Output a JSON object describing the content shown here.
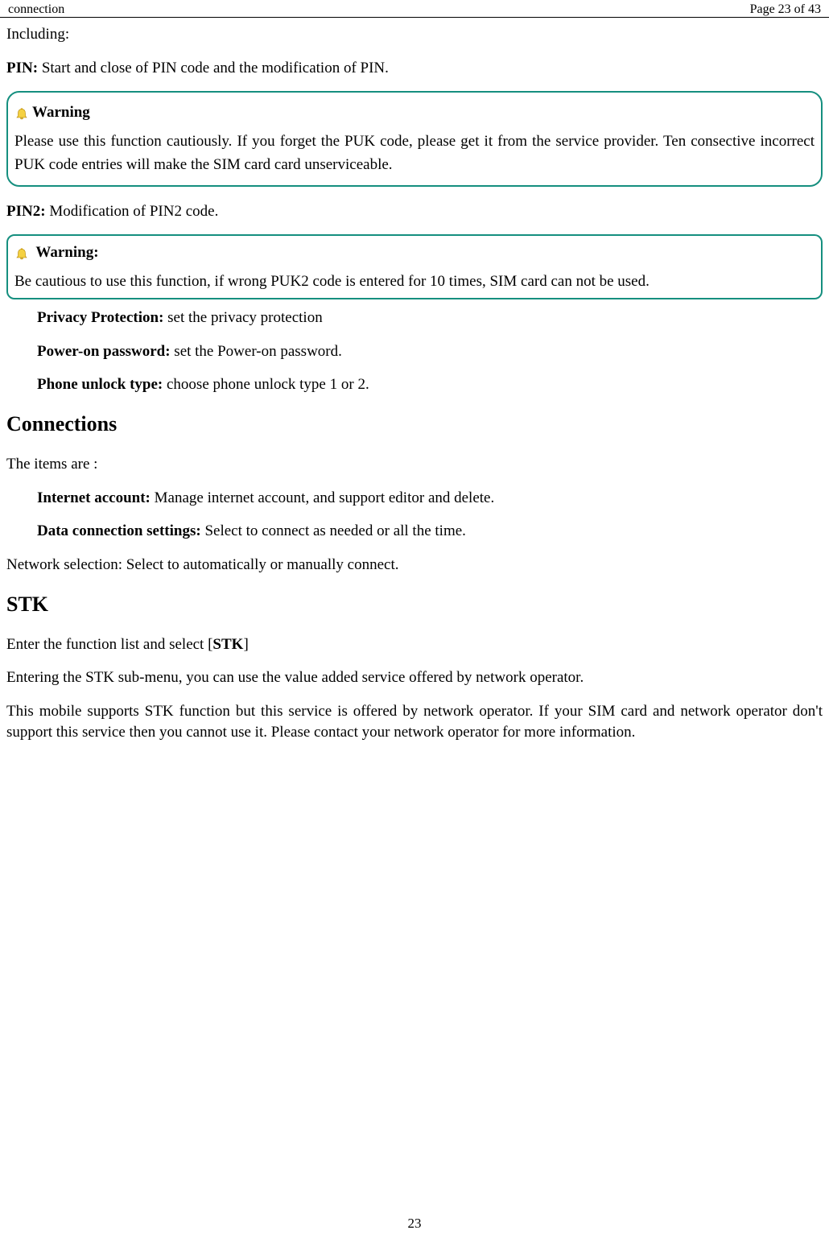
{
  "header": {
    "left": "connection",
    "right": "Page 23 of 43"
  },
  "bodyText": {
    "including": "Including:",
    "pinLabel": "PIN:",
    "pinDesc": " Start and close of PIN code and the modification of PIN.",
    "warning1Label": "Warning",
    "warning1Body": "Please use this function cautiously. If you forget the PUK code, please get it from the service provider. Ten consective incorrect PUK code entries will make the SIM card card unserviceable.",
    "pin2Label": "PIN2:",
    "pin2Desc": " Modification of PIN2 code.",
    "warning2Label": "  Warning:",
    "warning2Body": "Be cautious to use this function, if wrong PUK2 code is entered for 10 times, SIM card can not be used.",
    "privacyLabel": "Privacy Protection:",
    "privacyDesc": " set the privacy protection",
    "powerLabel": "Power-on password:",
    "powerDesc": " set the Power-on password.",
    "unlockLabel": "Phone unlock type:",
    "unlockDesc": " choose phone unlock type 1 or 2.",
    "connectionsHeading": "Connections",
    "itemsAre": "The items are :",
    "internetLabel": "Internet account:",
    "internetDesc": " Manage internet account, and support editor and delete.",
    "dataConnLabel": "Data connection settings:",
    "dataConnDesc": " Select to connect as needed or all the time.",
    "networkSel": "Network selection: Select to automatically or manually connect.",
    "stkHeading": "STK",
    "stkLine1a": "Enter the function list and select [",
    "stkLine1b": "STK",
    "stkLine1c": "]",
    "stkLine2": "Entering the STK sub-menu, you can use the value added service offered by network operator.",
    "stkLine3": "This mobile supports STK function but this service is offered by network operator. If your SIM card and network operator don't support this service then you cannot use it. Please contact your network operator for more information."
  },
  "pageNumber": "23"
}
